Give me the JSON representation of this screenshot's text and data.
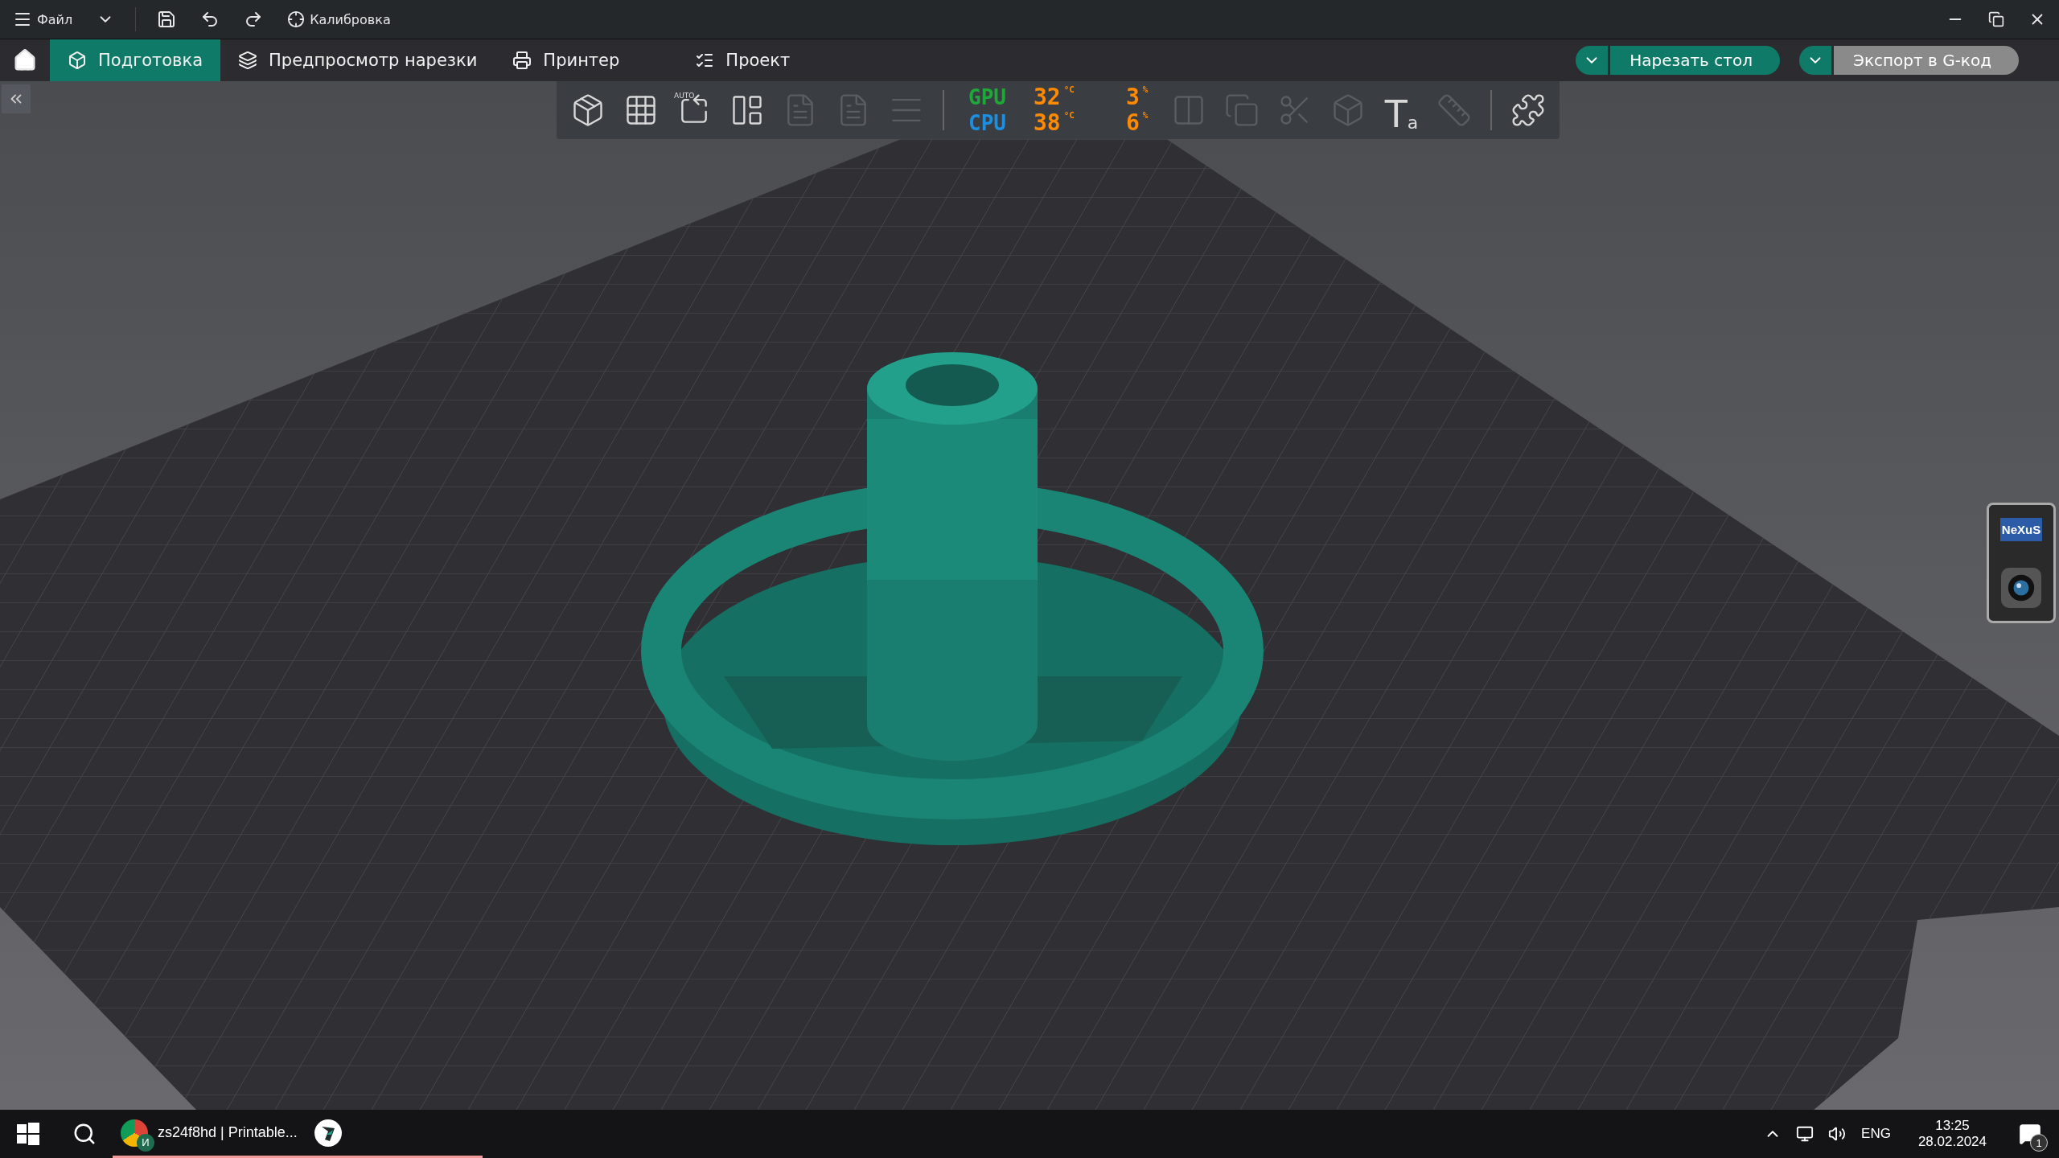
{
  "title_bar": {
    "menu_label": "Файл",
    "calibration_label": "Калибровка"
  },
  "tabs": [
    {
      "kind": "cube",
      "label": "Подготовка",
      "selected": true
    },
    {
      "kind": "layers",
      "label": "Предпросмотр нарезки",
      "selected": false
    },
    {
      "kind": "printer",
      "label": "Принтер",
      "selected": false
    },
    {
      "kind": "list",
      "label": "Проект",
      "selected": false
    }
  ],
  "actions": [
    {
      "label": "Нарезать стол",
      "disabled": false
    },
    {
      "label": "Экспорт в G-код",
      "disabled": true
    }
  ],
  "toolbar": {
    "left": [
      {
        "kind": "add-model",
        "disabled": false
      },
      {
        "kind": "add-plate",
        "disabled": false
      },
      {
        "kind": "auto-orient",
        "badge": "AUTO",
        "disabled": false
      },
      {
        "kind": "arrange",
        "disabled": false
      },
      {
        "kind": "document",
        "disabled": true
      },
      {
        "kind": "document",
        "disabled": true
      },
      {
        "kind": "lines",
        "disabled": true
      }
    ],
    "monitor": [
      {
        "label": "GPU",
        "color": "#1fa83a",
        "temp": "32",
        "temp_unit": "°C",
        "load": "3",
        "load_unit": "%"
      },
      {
        "label": "CPU",
        "color": "#1d8fe0",
        "temp": "38",
        "temp_unit": "°C",
        "load": "6",
        "load_unit": "%"
      }
    ],
    "right": [
      {
        "kind": "split",
        "disabled": true
      },
      {
        "kind": "copy",
        "disabled": true
      },
      {
        "kind": "cut",
        "disabled": true
      },
      {
        "kind": "box",
        "disabled": true
      },
      {
        "kind": "text",
        "glyph": "T",
        "sub": "a",
        "disabled": false
      },
      {
        "kind": "ruler",
        "disabled": true
      },
      {
        "kind": "separator"
      },
      {
        "kind": "puzzle",
        "disabled": false
      }
    ]
  },
  "nexus_dock": {
    "logo": "NeXuS"
  },
  "taskbar": {
    "apps": [
      {
        "kind": "browser",
        "label": "zs24f8hd | Printable...",
        "badge": "И"
      },
      {
        "kind": "slicer"
      }
    ],
    "tray": {
      "language": "ENG",
      "time": "13:25",
      "date": "28.02.2024",
      "notifications": "1"
    }
  }
}
